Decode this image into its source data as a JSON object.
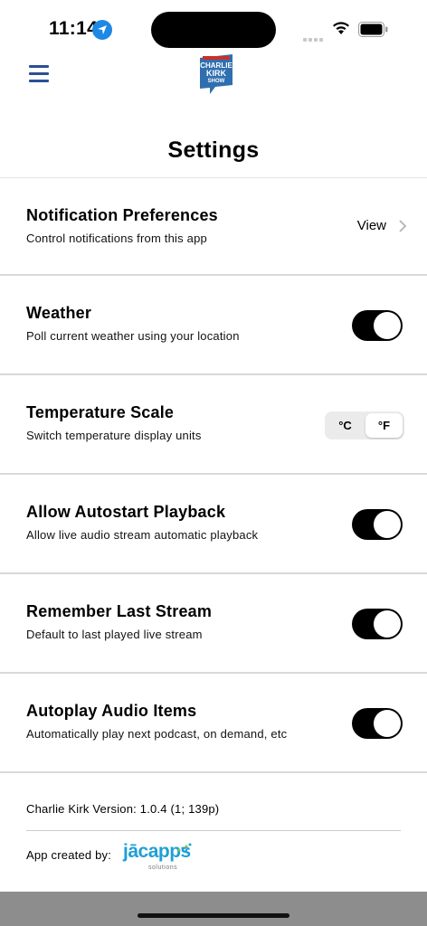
{
  "status_bar": {
    "time": "11:14",
    "icons": [
      "location-arrow-icon",
      "cellular-signal-icon",
      "wifi-icon",
      "battery-icon"
    ]
  },
  "nav": {
    "menu_icon": "hamburger-menu-icon",
    "logo_text": "CHARLIE KIRK SHOW"
  },
  "page": {
    "title": "Settings"
  },
  "settings": [
    {
      "title": "Notification Preferences",
      "subtitle": "Control notifications from this app",
      "control": "link",
      "link_label": "View"
    },
    {
      "title": "Weather",
      "subtitle": "Poll current weather using your location",
      "control": "toggle",
      "on": true
    },
    {
      "title": "Temperature Scale",
      "subtitle": "Switch temperature display units",
      "control": "segmented",
      "options": [
        "°C",
        "°F"
      ],
      "selected": "°F"
    },
    {
      "title": "Allow Autostart Playback",
      "subtitle": "Allow live audio stream automatic playback",
      "control": "toggle",
      "on": true
    },
    {
      "title": "Remember Last Stream",
      "subtitle": "Default to last played live stream",
      "control": "toggle",
      "on": true
    },
    {
      "title": "Autoplay Audio Items",
      "subtitle": "Automatically play next podcast, on demand, etc",
      "control": "toggle",
      "on": true
    }
  ],
  "footer": {
    "version": "Charlie Kirk Version: 1.0.4 (1; 139p)",
    "credit_label": "App created by:",
    "credit_logo_text": "jācapps",
    "credit_logo_sub": "solutions"
  },
  "colors": {
    "accent": "#2a4f96",
    "toggle_on": "#000000",
    "location_blue": "#1e88e5",
    "jacapps_blue": "#1f9fd6",
    "home_bar_bg": "#8d8d8d"
  }
}
